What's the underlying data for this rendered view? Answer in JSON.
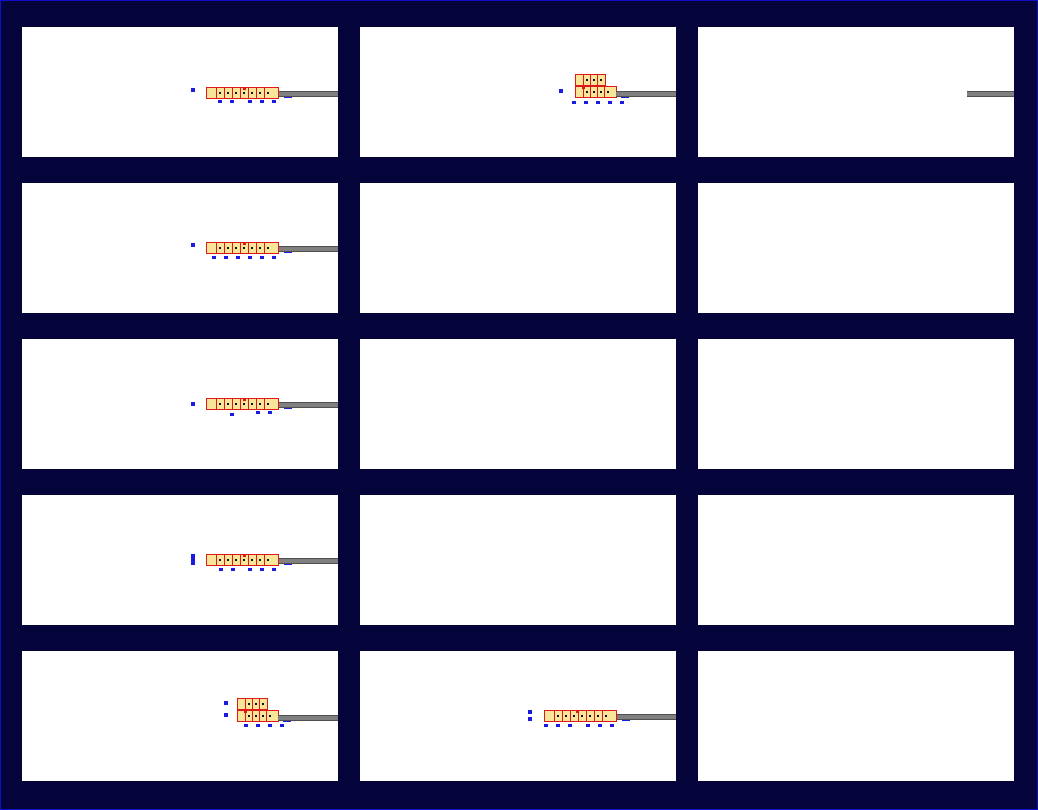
{
  "colors": {
    "background": "#04043a",
    "panel": "#ffffff",
    "dock": "#808080",
    "car_fill": "#f7e69a",
    "car_border": "#e01818",
    "marker": "#1a1ae0"
  },
  "grid": {
    "rows": 5,
    "columns": 3
  },
  "panels": [
    {
      "id": "r1c1",
      "row": 1,
      "column": 1,
      "has_dock": true,
      "train": "single-deck"
    },
    {
      "id": "r1c2",
      "row": 1,
      "column": 2,
      "has_dock": true,
      "train": "double-deck"
    },
    {
      "id": "r1c3",
      "row": 1,
      "column": 3,
      "has_dock": true,
      "train": "none"
    },
    {
      "id": "r2c1",
      "row": 2,
      "column": 1,
      "has_dock": true,
      "train": "single-deck"
    },
    {
      "id": "r2c2",
      "row": 2,
      "column": 2,
      "has_dock": false,
      "train": "none"
    },
    {
      "id": "r2c3",
      "row": 2,
      "column": 3,
      "has_dock": false,
      "train": "none"
    },
    {
      "id": "r3c1",
      "row": 3,
      "column": 1,
      "has_dock": true,
      "train": "single-deck"
    },
    {
      "id": "r3c2",
      "row": 3,
      "column": 2,
      "has_dock": false,
      "train": "none"
    },
    {
      "id": "r3c3",
      "row": 3,
      "column": 3,
      "has_dock": false,
      "train": "none"
    },
    {
      "id": "r4c1",
      "row": 4,
      "column": 1,
      "has_dock": true,
      "train": "single-deck"
    },
    {
      "id": "r4c2",
      "row": 4,
      "column": 2,
      "has_dock": false,
      "train": "none"
    },
    {
      "id": "r4c3",
      "row": 4,
      "column": 3,
      "has_dock": false,
      "train": "none"
    },
    {
      "id": "r5c1",
      "row": 5,
      "column": 1,
      "has_dock": true,
      "train": "double-deck"
    },
    {
      "id": "r5c2",
      "row": 5,
      "column": 2,
      "has_dock": true,
      "train": "single-deck"
    },
    {
      "id": "r5c3",
      "row": 5,
      "column": 3,
      "has_dock": false,
      "train": "none"
    }
  ]
}
